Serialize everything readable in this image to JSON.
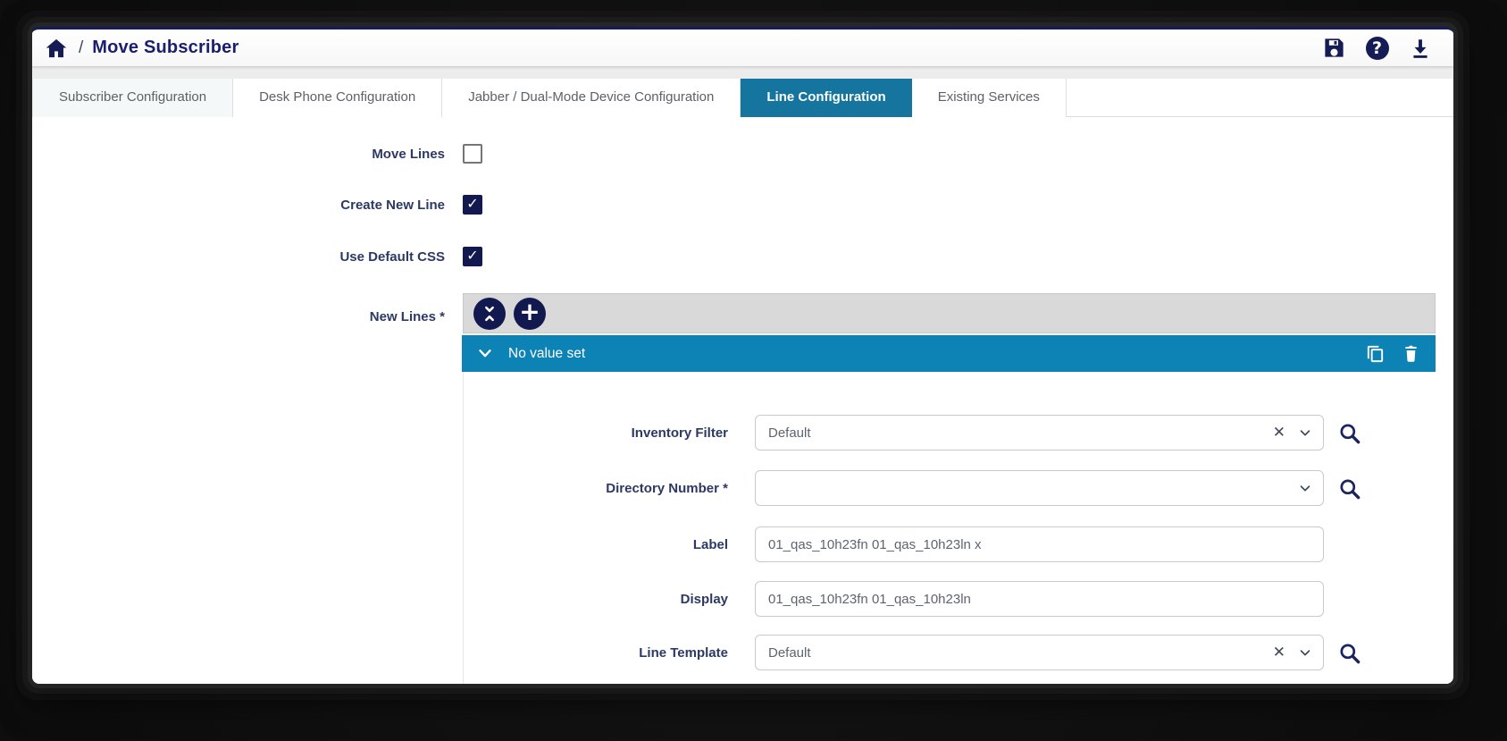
{
  "header": {
    "breadcrumb_separator": "/",
    "title": "Move Subscriber",
    "icons": [
      "home-icon",
      "save-icon",
      "help-icon",
      "download-icon"
    ]
  },
  "tabs": [
    {
      "label": "Subscriber Configuration",
      "active": false
    },
    {
      "label": "Desk Phone Configuration",
      "active": false
    },
    {
      "label": "Jabber / Dual-Mode Device Configuration",
      "active": false
    },
    {
      "label": "Line Configuration",
      "active": true
    },
    {
      "label": "Existing Services",
      "active": false
    }
  ],
  "form": {
    "checkboxes": [
      {
        "label": "Move Lines",
        "checked": false
      },
      {
        "label": "Create New Line",
        "checked": true
      },
      {
        "label": "Use Default CSS",
        "checked": true
      }
    ],
    "new_lines": {
      "label": "New Lines *",
      "toolbar_icons": [
        "collapse-icon",
        "add-icon"
      ],
      "group_header": "No value set",
      "group_header_icons": [
        "chevron-down-icon",
        "copy-icon",
        "delete-icon"
      ],
      "fields": [
        {
          "label": "Inventory Filter",
          "value": "Default",
          "type": "combo-clearable",
          "icons": [
            "clear-icon",
            "chevron-down-icon",
            "search-icon"
          ]
        },
        {
          "label": "Directory Number *",
          "value": "",
          "type": "combo",
          "icons": [
            "chevron-down-icon",
            "search-icon"
          ]
        },
        {
          "label": "Label",
          "value": "01_qas_10h23fn 01_qas_10h23ln x",
          "type": "text",
          "icons": []
        },
        {
          "label": "Display",
          "value": "01_qas_10h23fn 01_qas_10h23ln",
          "type": "text",
          "icons": []
        },
        {
          "label": "Line Template",
          "value": "Default",
          "type": "combo-clearable",
          "icons": [
            "clear-icon",
            "chevron-down-icon",
            "search-icon"
          ]
        }
      ]
    }
  },
  "icons": {
    "help_glyph": "?",
    "plus_glyph": "+",
    "check_glyph": "✓",
    "clear_glyph": "✕"
  },
  "colors": {
    "navy": "#151c55",
    "title_navy": "#1b1e6e",
    "label_navy": "#2c3964",
    "checkbox_checked": "#12194f",
    "active_tab": "#15759e",
    "group_header_bar": "#0d82b4",
    "toolbar_gray": "#d9d9d9",
    "frame_dark": "#0e0e0e"
  }
}
